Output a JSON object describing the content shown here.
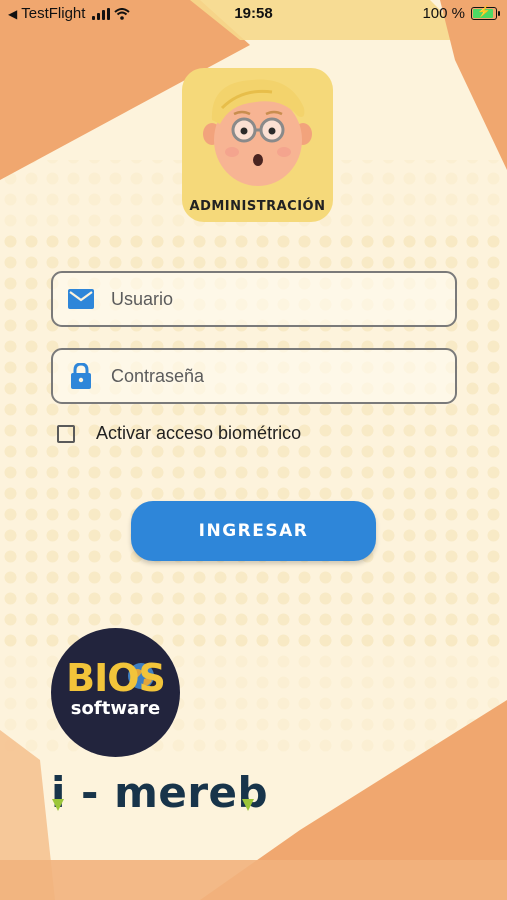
{
  "status_bar": {
    "back_app": "TestFlight",
    "time": "19:58",
    "battery": "100 %",
    "battery_level": 1.0
  },
  "avatar": {
    "caption": "ADMINISTRACIÓN"
  },
  "form": {
    "username_placeholder": "Usuario",
    "password_placeholder": "Contraseña",
    "biometric_label": "Activar acceso biométrico",
    "biometric_checked": false,
    "submit_label": "INGRESAR"
  },
  "branding": {
    "bios_line1": "BIOS",
    "bios_line2": "software",
    "product": "i - mereb"
  },
  "colors": {
    "accent": "#2e86d9",
    "background": "#fdf3dc",
    "decor_orange": "#f0a76f",
    "avatar_bg": "#f5d97a",
    "bios_gold": "#f2c43a",
    "bios_navy": "#22243d",
    "mereb_navy": "#18344a",
    "mereb_green": "#9cc63a"
  },
  "icons": {
    "username": "mail-icon",
    "password": "lock-icon",
    "wifi": "wifi-icon",
    "signal": "signal-icon",
    "battery": "battery-icon"
  }
}
